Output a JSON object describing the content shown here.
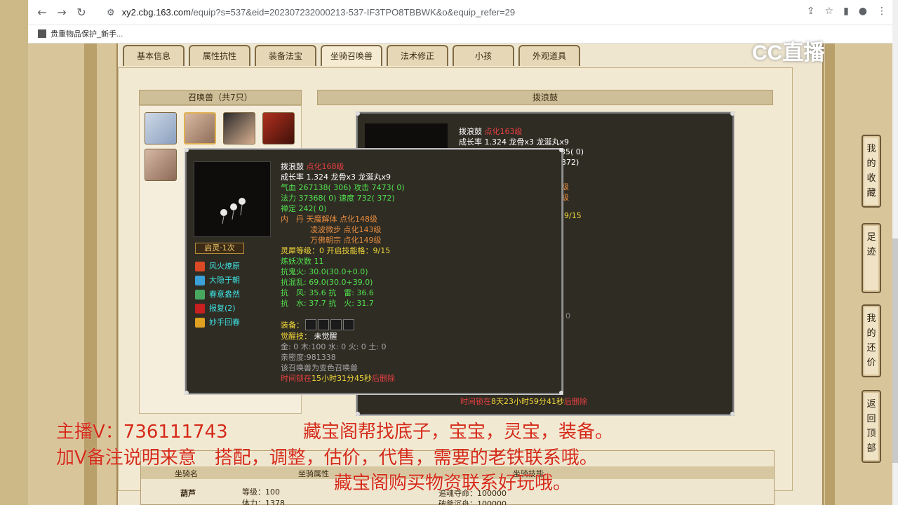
{
  "browser": {
    "url_domain": "xy2.cbg.163.com",
    "url_path": "/equip?s=537&eid=202307232000213-537-IF3TPO8TBBWK&o&equip_refer=29",
    "bookmark": "贵重物品保护_新手..."
  },
  "tabs": [
    "基本信息",
    "属性抗性",
    "装备法宝",
    "坐骑召唤兽",
    "法术修正",
    "小孩",
    "外观道具"
  ],
  "active_tab_index": 3,
  "pet_list": {
    "title": "召唤兽（共7只）"
  },
  "detail_panel": {
    "title": "拨浪鼓"
  },
  "tooltip": {
    "name": "拨浪鼓",
    "level": "点化168级",
    "growth": "成长率 1.324 龙骨x3 龙涎丸x9",
    "hp_label": "气血",
    "hp": "267138( 306)",
    "atk_label": "攻击",
    "atk": "7473( 0)",
    "mp_label": "法力",
    "mp": "37368( 0)",
    "spd_label": "速度",
    "spd": "732( 372)",
    "zen_label": "禅定",
    "zen": "242( 0)",
    "neidan_label": "内　丹",
    "neidan": [
      "天魔解体 点化148级",
      "凌波微步 点化143级",
      "万佛朝宗 点化149级"
    ],
    "lingxi_label": "灵犀等级：",
    "lingxi": "0 开启技能格：9/15",
    "lianyao": "炼妖次数 11",
    "res": [
      "抗鬼火: 30.0(30.0+0.0)",
      "抗混乱: 69.0(30.0+39.0)",
      "抗　风: 35.6 抗　雷: 36.6",
      "抗　水: 37.7 抗　火: 31.7"
    ],
    "equip_label": "装备：",
    "awaken_label": "觉醒技：",
    "awaken": "未觉醒",
    "elements": "金: 0 木:100 水: 0 火: 0 土: 0",
    "intimacy": "亲密度:981338",
    "transform": "该召唤兽为变色召唤兽",
    "time_prefix": "时间锁在",
    "time": "15小时31分45秒",
    "time_suffix": "后删除",
    "badge": "启灵·1次",
    "skills": [
      "风火燎原",
      "大隐于朝",
      "春意盎然",
      "报复(2)",
      "妙手回春"
    ]
  },
  "big_panel": {
    "name": "拨浪鼓",
    "level": "点化163级",
    "growth": "成长率 1.324 龙骨x3 龙涎丸x9",
    "peek1": "035( 0)",
    "peek2": "372)",
    "peek3": "级",
    "peek4": "级",
    "peek5": "9/15",
    "peek6": "0",
    "time_prefix": "时间锁在",
    "time": "8天23小时59分41秒",
    "time_suffix": "后删除"
  },
  "side_buttons": [
    "我的收藏",
    "足迹",
    "我的还价",
    "返回顶部"
  ],
  "bottom_table": {
    "h1": "坐骑名",
    "h2": "坐骑属性",
    "h3": "坐骑技能",
    "name": "葫芦",
    "lvl": "等级：100",
    "hp": "体力：1378",
    "s1": "追魂夺命：100000",
    "s2": "破釜沉舟：100000"
  },
  "overlay": {
    "line1a": "主播V：736111743",
    "line1b": "藏宝阁帮找底子，宝宝，灵宝，装备。",
    "line2": "加V备注说明来意　搭配，调整，估价，代售，需要的老铁联系哦。",
    "line3": "藏宝阁购买物资联系好玩哦。",
    "logo": "CC直播"
  },
  "colors": {
    "accent_red": "#d42a17",
    "green_text": "#52e24e",
    "yellow_text": "#f4d93a",
    "skill_cyan": "#3ee2e2"
  }
}
